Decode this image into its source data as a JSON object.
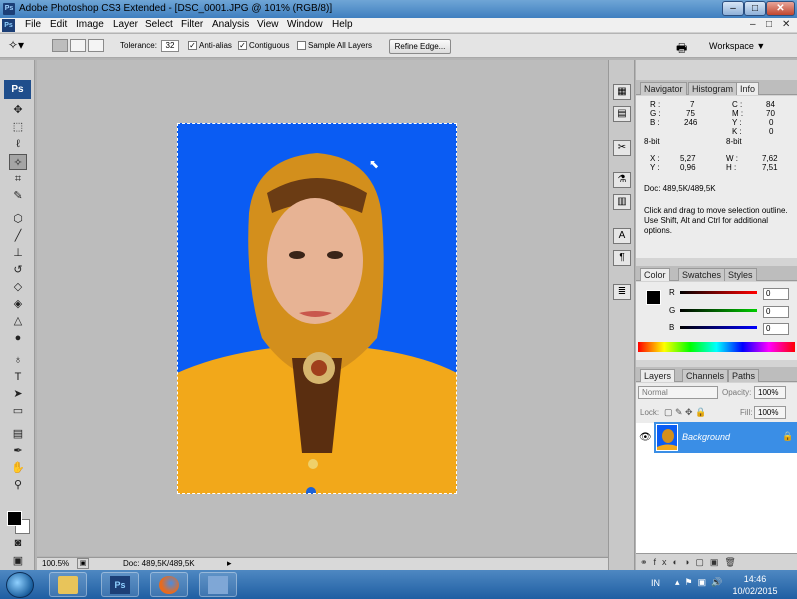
{
  "window": {
    "title": "Adobe Photoshop CS3 Extended - [DSC_0001.JPG @ 101% (RGB/8)]",
    "app_icon": "Ps",
    "buttons": {
      "minimize": "–",
      "maximize": "□",
      "close": "✕"
    }
  },
  "menu": {
    "items": [
      "File",
      "Edit",
      "Image",
      "Layer",
      "Select",
      "Filter",
      "Analysis",
      "View",
      "Window",
      "Help"
    ],
    "doc_buttons": {
      "minimize": "–",
      "restore": "□",
      "close": "✕"
    }
  },
  "options_bar": {
    "tool_icon": "magic-wand-icon",
    "tolerance_label": "Tolerance:",
    "tolerance_value": "32",
    "anti_alias_label": "Anti-alias",
    "anti_alias_checked": true,
    "contiguous_label": "Contiguous",
    "contiguous_checked": true,
    "sample_all_label": "Sample All Layers",
    "sample_all_checked": false,
    "refine_edge_label": "Refine Edge...",
    "workspace_label": "Workspace ▼"
  },
  "toolbox": {
    "logo": "Ps",
    "tools": [
      "move-icon",
      "marquee-icon",
      "lasso-icon",
      "magic-wand-icon",
      "crop-icon",
      "eyedropper-icon",
      "healing-icon",
      "brush-icon",
      "stamp-icon",
      "history-brush-icon",
      "eraser-icon",
      "paint-bucket-icon",
      "blur-icon",
      "dodge-icon",
      "pen-icon",
      "type-icon",
      "path-select-icon",
      "rectangle-icon",
      "notes-icon",
      "eyedropper2-icon",
      "hand-icon",
      "zoom-icon"
    ]
  },
  "status_bar": {
    "zoom": "100.5%",
    "doc_info": "Doc: 489,5K/489,5K"
  },
  "info_panel": {
    "tabs": [
      "Navigator",
      "Histogram",
      "Info"
    ],
    "active_tab": "Info",
    "rgb": {
      "r_label": "R :",
      "r": "7",
      "g_label": "G :",
      "g": "75",
      "b_label": "B :",
      "b": "246"
    },
    "cmyk": {
      "c_label": "C :",
      "c": "84",
      "m_label": "M :",
      "m": "70",
      "y_label": "Y :",
      "y": "0",
      "k_label": "K :",
      "k": "0"
    },
    "bit_left": "8-bit",
    "bit_right": "8-bit",
    "x_label": "X :",
    "x": "5,27",
    "y_label": "Y :",
    "y": "0,96",
    "w_label": "W :",
    "w": "7,62",
    "h_label": "H :",
    "h": "7,51",
    "doc": "Doc: 489,5K/489,5K",
    "hint": "Click and drag to move selection outline. Use Shift, Alt and Ctrl for additional options."
  },
  "color_panel": {
    "tabs": [
      "Color",
      "Swatches",
      "Styles"
    ],
    "active_tab": "Color",
    "r_label": "R",
    "r": "0",
    "g_label": "G",
    "g": "0",
    "b_label": "B",
    "b": "0"
  },
  "layers_panel": {
    "tabs": [
      "Layers",
      "Channels",
      "Paths"
    ],
    "active_tab": "Layers",
    "blend_mode": "Normal",
    "opacity_label": "Opacity:",
    "opacity": "100%",
    "lock_label": "Lock:",
    "fill_label": "Fill:",
    "fill": "100%",
    "layer_name": "Background"
  },
  "taskbar": {
    "lang": "IN",
    "time": "14:46",
    "date": "10/02/2015",
    "ps_label": "Ps"
  },
  "colors": {
    "photo_bg": "#0a5cf3",
    "layer_selected": "#3a8ee6",
    "clothing": "#f2a81a"
  }
}
